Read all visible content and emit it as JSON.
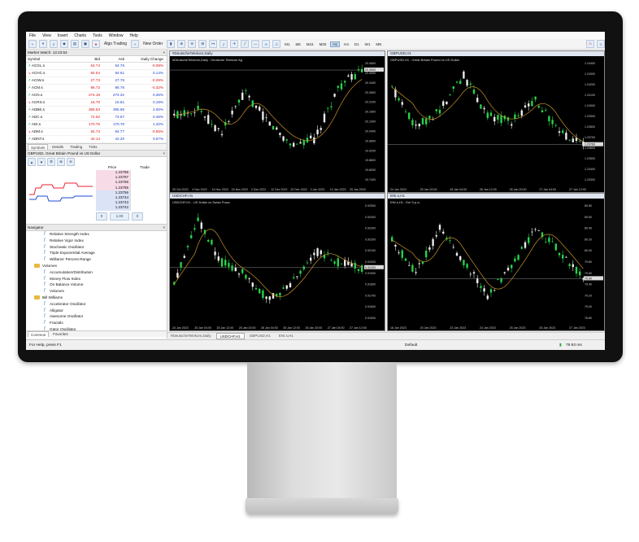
{
  "menu": [
    "File",
    "View",
    "Insert",
    "Charts",
    "Tools",
    "Window",
    "Help"
  ],
  "toolbar": {
    "algo_label": "Algo Trading",
    "new_order_label": "New Order",
    "timeframes": [
      "M1",
      "M5",
      "M15",
      "M30",
      "H1",
      "H4",
      "D1",
      "W1",
      "MN"
    ],
    "active_timeframe": "H1"
  },
  "market_watch": {
    "title": "Market Watch: 13:23:53",
    "headers": [
      "Symbol",
      "Bid",
      "Ask",
      "Daily Change"
    ],
    "rows": [
      {
        "symbol": "ACGL.s",
        "bid": "64.74",
        "ask": "64.76",
        "change": "-0.09%",
        "dir": "up"
      },
      {
        "symbol": "ACHC.s",
        "bid": "84.54",
        "ask": "84.61",
        "change": "0.14%",
        "dir": "dn"
      },
      {
        "symbol": "ACIW.s",
        "bid": "27.73",
        "ask": "27.76",
        "change": "-0.29%",
        "dir": "up"
      },
      {
        "symbol": "ACM.s",
        "bid": "86.72",
        "ask": "86.76",
        "change": "-0.32%",
        "dir": "up"
      },
      {
        "symbol": "ACN.s",
        "bid": "274.18",
        "ask": "274.22",
        "change": "0.36%",
        "dir": "up"
      },
      {
        "symbol": "ACRS.s",
        "bid": "16.70",
        "ask": "16.81",
        "change": "0.18%",
        "dir": "dn"
      },
      {
        "symbol": "ADBE.s",
        "bid": "365.53",
        "ask": "365.69",
        "change": "2.06%",
        "dir": "up"
      },
      {
        "symbol": "ADC.s",
        "bid": "74.52",
        "ask": "74.67",
        "change": "0.46%",
        "dir": "up"
      },
      {
        "symbol": "ADI.s",
        "bid": "170.75",
        "ask": "170.78",
        "change": "1.32%",
        "dir": "up"
      },
      {
        "symbol": "ADM.s",
        "bid": "84.74",
        "ask": "84.77",
        "change": "-0.55%",
        "dir": "dn"
      },
      {
        "symbol": "ADNT.s",
        "bid": "42.14",
        "ask": "42.20",
        "change": "0.57%",
        "dir": "up"
      }
    ],
    "tabs": [
      "Symbols",
      "Details",
      "Trading",
      "Ticks"
    ]
  },
  "depth": {
    "title": "GBPUSD, Great Britain Pound vs US Dollar",
    "price_header": "Price",
    "trade_header": "Trade",
    "prices": [
      "1.23788",
      "1.23787",
      "1.23786",
      "1.23785",
      "1.23756",
      "1.23744",
      "1.23743",
      "1.23742"
    ],
    "volume_value": "1.00",
    "spin_left": "0",
    "spin_right": "0"
  },
  "navigator": {
    "title": "Navigator",
    "items": [
      {
        "label": "Relative Strength Index",
        "type": "ind",
        "indent": 2
      },
      {
        "label": "Relative Vigor Index",
        "type": "ind",
        "indent": 2
      },
      {
        "label": "Stochastic Oscillator",
        "type": "ind",
        "indent": 2
      },
      {
        "label": "Triple Exponential Average",
        "type": "ind",
        "indent": 2
      },
      {
        "label": "Williams' Percent Range",
        "type": "ind",
        "indent": 2
      },
      {
        "label": "Volumes",
        "type": "folder",
        "indent": 1
      },
      {
        "label": "Accumulation/Distribution",
        "type": "ind",
        "indent": 2
      },
      {
        "label": "Money Flow Index",
        "type": "ind",
        "indent": 2
      },
      {
        "label": "On Balance Volume",
        "type": "ind",
        "indent": 2
      },
      {
        "label": "Volumes",
        "type": "ind",
        "indent": 2
      },
      {
        "label": "Bill Williams",
        "type": "folder",
        "indent": 1
      },
      {
        "label": "Accelerator Oscillator",
        "type": "ind",
        "indent": 2
      },
      {
        "label": "Alligator",
        "type": "ind",
        "indent": 2
      },
      {
        "label": "Awesome Oscillator",
        "type": "ind",
        "indent": 2
      },
      {
        "label": "Fractals",
        "type": "ind",
        "indent": 2
      },
      {
        "label": "Gator Oscillator",
        "type": "ind",
        "indent": 2
      },
      {
        "label": "Market Facilitation Index",
        "type": "ind",
        "indent": 2
      }
    ],
    "tabs": [
      "Common",
      "Favorites"
    ]
  },
  "charts": [
    {
      "title": "#DeutscheTelekom,Daily",
      "subtitle": "#DeutscheTelekom,Daily : Deutsche Telekom Ag",
      "y": [
        "20.4600",
        "20.4000",
        "20.3400",
        "20.2800",
        "20.2200",
        "20.1600",
        "20.1000",
        "20.0400",
        "19.9800",
        "19.9200",
        "19.8600",
        "19.8000",
        "19.7400"
      ],
      "x": [
        "25 Oct 2022",
        "4 Nov 2022",
        "14 Nov 2022",
        "24 Nov 2022",
        "2 Dec 2022",
        "12 Dec 2022",
        "22 Dec 2022",
        "3 Jan 2023",
        "13 Jan 2023",
        "25 Jan 2023"
      ],
      "last": "20.3000"
    },
    {
      "title": "GBPUSD,H1",
      "subtitle": "GBPUSD,H1 : Great Britain Pound vs US Dollar",
      "y": [
        "1.24400",
        "1.24300",
        "1.24200",
        "1.24100",
        "1.24000",
        "1.23900",
        "1.23800",
        "1.23700",
        "1.23600",
        "1.23500",
        "1.23400",
        "1.23300"
      ],
      "x": [
        "24 Jan 2023",
        "25 Jan 20:00",
        "26 Jan 04:00",
        "26 Jan 12:00",
        "26 Jan 20:00",
        "27 Jan 04:00",
        "27 Jan 12:00"
      ],
      "last": "1.23760"
    },
    {
      "title": "USDCHF,H1",
      "subtitle": "USDCHF,H1 : US Dollar vs Swiss Franc",
      "y": [
        "0.92500",
        "0.92400",
        "0.92300",
        "0.92200",
        "0.92100",
        "0.92000",
        "0.91900",
        "0.91800",
        "0.91700",
        "0.91600",
        "0.91500"
      ],
      "x": [
        "24 Jan 2023",
        "25 Jan 04:00",
        "25 Jan 12:00",
        "25 Jan 20:00",
        "26 Jan 04:00",
        "26 Jan 12:00",
        "26 Jan 20:00",
        "27 Jan 04:00",
        "27 Jan 12:00"
      ],
      "last": "0.92200"
    },
    {
      "title": "ENI.s,H1",
      "subtitle": "ENI.s,H1 : Eni S.p.a.",
      "y": [
        "80.80",
        "80.60",
        "80.40",
        "80.20",
        "80.00",
        "79.80",
        "79.60",
        "79.40",
        "79.20",
        "79.00",
        "78.80"
      ],
      "x": [
        "18 Jan 2023",
        "20 Jan 2023",
        "23 Jan 2023",
        "24 Jan 2023",
        "25 Jan 2023",
        "26 Jan 2023",
        "27 Jan 2023"
      ],
      "last": "79.90"
    }
  ],
  "chart_tabs": [
    "#DeutscheTelekom,Daily",
    "USDCHF,H1",
    "GBPUSD,H1",
    "ENI.s,H1"
  ],
  "status": {
    "help": "For Help, press F1",
    "profile": "Default",
    "signal": "79.93 ms"
  },
  "colors": {
    "bull": "#27d24a",
    "bear": "#eaeaea",
    "ma": "#c8922a",
    "bg": "#000000",
    "bid": "#d11111"
  }
}
